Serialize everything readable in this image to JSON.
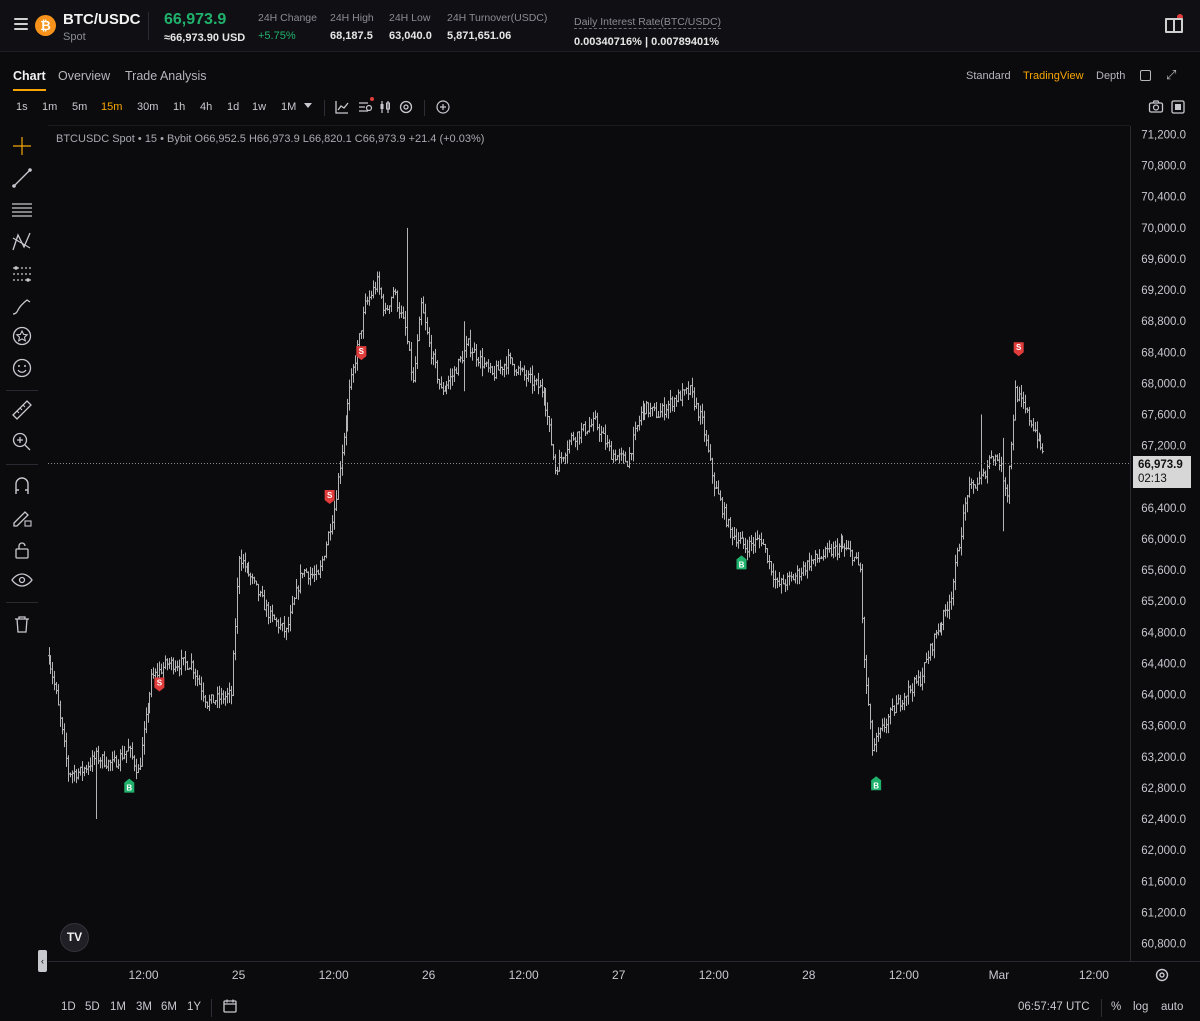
{
  "header": {
    "coin_symbol": "₿",
    "pair": "BTC/USDC",
    "market": "Spot",
    "last_price": "66,973.9",
    "last_price_usd": "≈66,973.90 USD",
    "stats": [
      {
        "label": "24H Change",
        "value": "+5.75%",
        "positive": true
      },
      {
        "label": "24H High",
        "value": "68,187.5"
      },
      {
        "label": "24H Low",
        "value": "63,040.0"
      },
      {
        "label": "24H Turnover(USDC)",
        "value": "5,871,651.06"
      },
      {
        "label": "Daily Interest Rate(BTC/USDC)",
        "value": "0.00340716% | 0.00789401%"
      }
    ]
  },
  "tabs": [
    "Chart",
    "Overview",
    "Trade Analysis"
  ],
  "active_tab": "Chart",
  "views": [
    "Standard",
    "TradingView",
    "Depth"
  ],
  "active_view": "TradingView",
  "intervals": [
    "1s",
    "1m",
    "5m",
    "15m",
    "30m",
    "1h",
    "4h",
    "1d",
    "1w",
    "1M"
  ],
  "active_interval": "15m",
  "legend": "BTCUSDC Spot • 15 • Bybit  O66,952.5  H66,973.9  L66,820.1  C66,973.9  +21.4 (+0.03%)",
  "current_price_tag": {
    "price": "66,973.9",
    "countdown": "02:13"
  },
  "tv_logo_text": "TV",
  "range_buttons": [
    "1D",
    "5D",
    "1M",
    "3M",
    "6M",
    "1Y"
  ],
  "clock": "06:57:47 UTC",
  "bottom_options": [
    "%",
    "log",
    "auto"
  ],
  "colors": {
    "up": "#20b26c",
    "accent": "#f7a600",
    "sell": "#e03c3c",
    "buy": "#20b26c",
    "candle": "#b4b4b4"
  },
  "chart_data": {
    "type": "ohlc",
    "symbol": "BTCUSDC",
    "interval": "15",
    "ylim": [
      60600,
      71400
    ],
    "y_ticks": [
      71200,
      70800,
      70400,
      70000,
      69600,
      69200,
      68800,
      68400,
      68000,
      67600,
      67200,
      66400,
      66000,
      65600,
      65200,
      64800,
      64400,
      64000,
      63600,
      63200,
      62800,
      62400,
      62000,
      61600,
      61200,
      60800
    ],
    "y_tick_labels": [
      "71,200.0",
      "70,800.0",
      "70,400.0",
      "70,000.0",
      "69,600.0",
      "69,200.0",
      "68,800.0",
      "68,400.0",
      "68,000.0",
      "67,600.0",
      "67,200.0",
      "66,400.0",
      "66,000.0",
      "65,600.0",
      "65,200.0",
      "64,800.0",
      "64,400.0",
      "64,000.0",
      "63,600.0",
      "63,200.0",
      "62,800.0",
      "62,400.0",
      "62,000.0",
      "61,600.0",
      "61,200.0",
      "60,800.0"
    ],
    "x_ticks": [
      "12:00",
      "25",
      "12:00",
      "26",
      "12:00",
      "27",
      "12:00",
      "28",
      "12:00",
      "Mar",
      "12:00"
    ],
    "x_tick_pos_hours": [
      12,
      24,
      36,
      48,
      60,
      72,
      84,
      96,
      108,
      120,
      132
    ],
    "last_price": 66973.9,
    "price_path": [
      [
        0,
        64500
      ],
      [
        1,
        64000
      ],
      [
        2.5,
        63000
      ],
      [
        4,
        63000
      ],
      [
        6,
        63200
      ],
      [
        8,
        63100
      ],
      [
        10,
        63300
      ],
      [
        11.3,
        63000
      ],
      [
        13,
        64200
      ],
      [
        15,
        64400
      ],
      [
        18,
        64400
      ],
      [
        20,
        63900
      ],
      [
        23,
        64000
      ],
      [
        24,
        65800
      ],
      [
        25.5,
        65500
      ],
      [
        28,
        65000
      ],
      [
        30,
        64800
      ],
      [
        32,
        65600
      ],
      [
        34,
        65500
      ],
      [
        36,
        66400
      ],
      [
        38,
        67900
      ],
      [
        40,
        69000
      ],
      [
        41.5,
        69300
      ],
      [
        42.5,
        68900
      ],
      [
        43.5,
        69200
      ],
      [
        45,
        68700
      ],
      [
        46,
        68000
      ],
      [
        47,
        69000
      ],
      [
        48,
        68500
      ],
      [
        49.5,
        67900
      ],
      [
        51,
        68100
      ],
      [
        53,
        68500
      ],
      [
        56,
        68100
      ],
      [
        58,
        68300
      ],
      [
        60,
        68100
      ],
      [
        62.5,
        67900
      ],
      [
        64,
        66900
      ],
      [
        66,
        67300
      ],
      [
        69,
        67500
      ],
      [
        71,
        67100
      ],
      [
        73,
        67000
      ],
      [
        75,
        67700
      ],
      [
        77,
        67600
      ],
      [
        79,
        67800
      ],
      [
        81,
        67900
      ],
      [
        82.5,
        67500
      ],
      [
        84,
        66700
      ],
      [
        86,
        66100
      ],
      [
        88,
        65900
      ],
      [
        90,
        66000
      ],
      [
        92,
        65400
      ],
      [
        94,
        65500
      ],
      [
        96,
        65700
      ],
      [
        98,
        65800
      ],
      [
        100,
        65900
      ],
      [
        101.5,
        65800
      ],
      [
        102.5,
        65600
      ],
      [
        103,
        64400
      ],
      [
        104,
        63300
      ],
      [
        106,
        63700
      ],
      [
        108,
        64000
      ],
      [
        110,
        64200
      ],
      [
        112,
        64800
      ],
      [
        113,
        65000
      ],
      [
        114,
        65300
      ],
      [
        116,
        66600
      ],
      [
        118,
        66800
      ],
      [
        119,
        67100
      ],
      [
        120,
        67000
      ],
      [
        121,
        66600
      ],
      [
        122,
        67900
      ],
      [
        123,
        67700
      ],
      [
        124.5,
        67400
      ],
      [
        125.5,
        67100
      ]
    ],
    "spikes": [
      {
        "t": 45.3,
        "high": 70000,
        "low": 68800
      },
      {
        "t": 52.5,
        "high": 68800,
        "low": 67900
      },
      {
        "t": 6,
        "high": 63300,
        "low": 62400
      },
      {
        "t": 120.5,
        "high": 67300,
        "low": 66100
      },
      {
        "t": 117.8,
        "high": 67600,
        "low": 66700
      }
    ],
    "markers": [
      {
        "side": "S",
        "t": 14,
        "price": 64040
      },
      {
        "side": "B",
        "t": 10.2,
        "price": 62920
      },
      {
        "side": "S",
        "t": 35.5,
        "price": 66450
      },
      {
        "side": "S",
        "t": 39.5,
        "price": 68300
      },
      {
        "side": "B",
        "t": 87.5,
        "price": 65790
      },
      {
        "side": "B",
        "t": 104.5,
        "price": 62950
      },
      {
        "side": "S",
        "t": 122.5,
        "price": 68350
      }
    ]
  }
}
